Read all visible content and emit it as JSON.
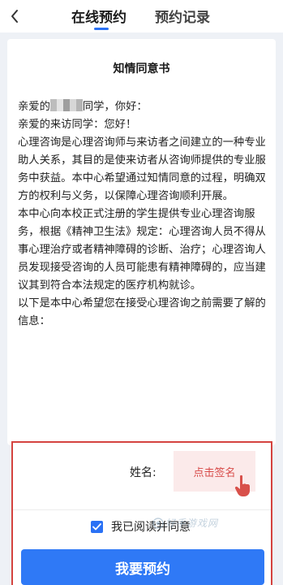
{
  "header": {
    "tabs": [
      {
        "label": "在线预约",
        "active": true
      },
      {
        "label": "预约记录",
        "active": false
      }
    ]
  },
  "consent": {
    "title": "知情同意书",
    "greeting_prefix": "亲爱的",
    "greeting_suffix": "同学，你好：",
    "paragraphs": [
      "亲爱的来访同学：您好！",
      "心理咨询是心理咨询师与来访者之间建立的一种专业助人关系，其目的是使来访者从咨询师提供的专业服务中获益。本中心希望通过知情同意的过程，明确双方的权利与义务，以保障心理咨询顺利开展。",
      "本中心向本校正式注册的学生提供专业心理咨询服务，根据《精神卫生法》规定：心理咨询人员不得从事心理治疗或者精神障碍的诊断、治疗；心理咨询人员发现接受咨询的人员可能患有精神障碍的，应当建议其到符合本法规定的医疗机构就诊。",
      "以下是本中心希望您在接受心理咨询之前需要了解的信息："
    ]
  },
  "signature": {
    "name_label": "姓名:",
    "sign_button": "点击签名",
    "agree_label": "我已阅读并同意",
    "agree_checked": true,
    "watermark": "好手游戏网",
    "submit_button": "我要预约"
  },
  "colors": {
    "accent": "#2f79f6",
    "highlight_border": "#d4433f",
    "sign_bg": "#fbeaea",
    "sign_text": "#d84c4a"
  },
  "icons": {
    "back": "chevron-left-icon",
    "pointer": "hand-pointer-icon",
    "check": "checkmark-icon"
  }
}
